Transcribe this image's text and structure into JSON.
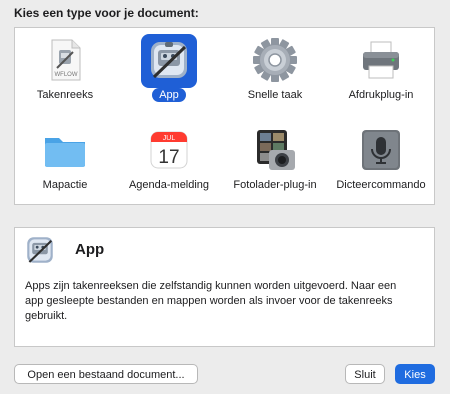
{
  "dialog": {
    "heading": "Kies een type voor je document:"
  },
  "types": [
    {
      "label": "Takenreeks",
      "icon": "workflow-document-icon",
      "icon_text": "WFLOW"
    },
    {
      "label": "App",
      "icon": "automator-robot-icon",
      "selected": true
    },
    {
      "label": "Snelle taak",
      "icon": "gear-icon"
    },
    {
      "label": "Afdrukplug-in",
      "icon": "printer-icon"
    },
    {
      "label": "Mapactie",
      "icon": "folder-icon"
    },
    {
      "label": "Agenda-melding",
      "icon": "calendar-icon",
      "month": "JUL",
      "day": "17"
    },
    {
      "label": "Fotolader-plug-in",
      "icon": "image-capture-icon"
    },
    {
      "label": "Dicteercommando",
      "icon": "microphone-icon"
    }
  ],
  "description": {
    "title": "App",
    "text": "Apps zijn takenreeksen die zelfstandig kunnen worden uitgevoerd. Naar een app gesleepte bestanden en mappen worden als invoer voor de takenreeks gebruikt."
  },
  "buttons": {
    "open_existing": "Open een bestaand document...",
    "close": "Sluit",
    "choose": "Kies"
  },
  "colors": {
    "accent": "#1f5fd6",
    "window_bg": "#ececec"
  }
}
